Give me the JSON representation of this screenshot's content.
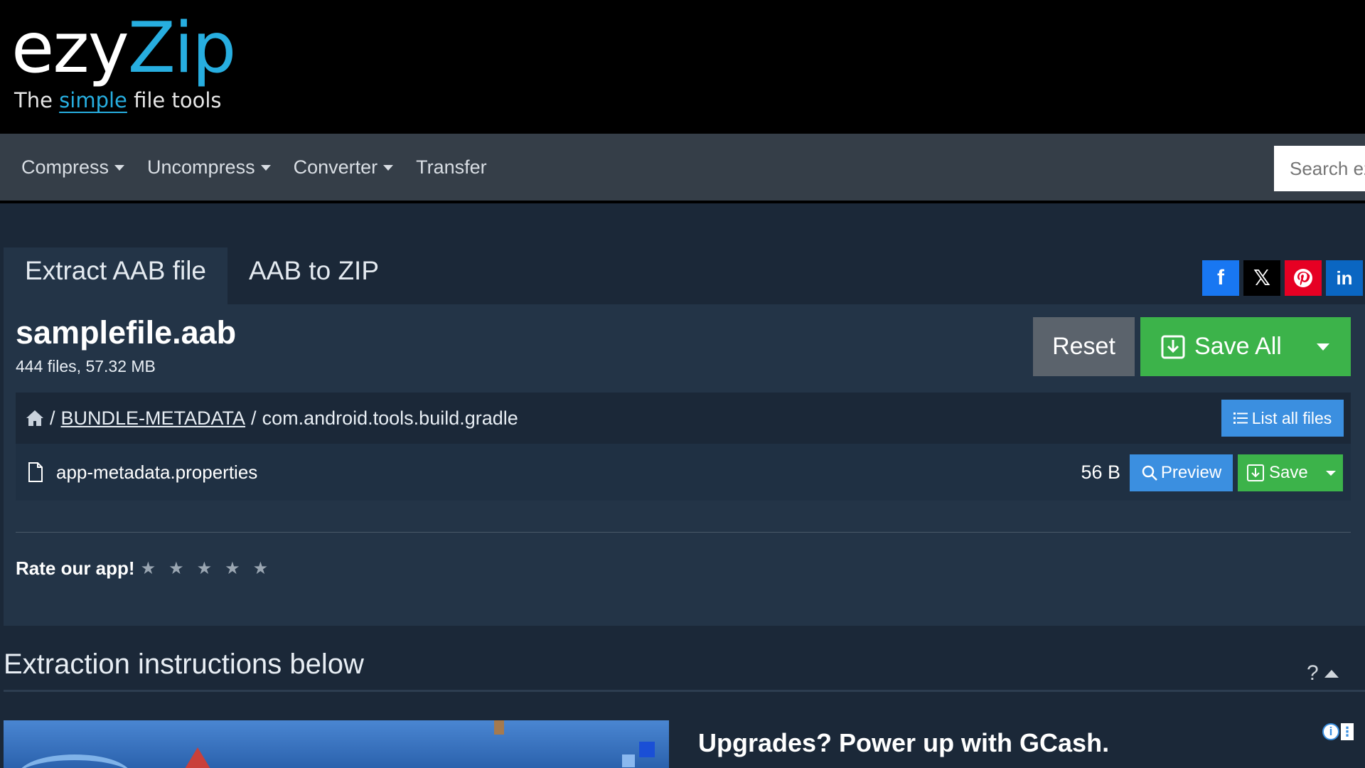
{
  "logo": {
    "word_left": "ezy",
    "word_right": "Zip",
    "tagline_pre": "The",
    "tagline_accent": "simple",
    "tagline_post": "file tools"
  },
  "nav": {
    "items": [
      {
        "label": "Compress",
        "has_dropdown": true
      },
      {
        "label": "Uncompress",
        "has_dropdown": true
      },
      {
        "label": "Converter",
        "has_dropdown": true
      },
      {
        "label": "Transfer",
        "has_dropdown": false
      }
    ],
    "search_placeholder": "Search ezyZip"
  },
  "tabs": [
    {
      "label": "Extract AAB file",
      "active": true
    },
    {
      "label": "AAB to ZIP",
      "active": false
    }
  ],
  "social": {
    "icons": [
      "facebook-icon",
      "x-icon",
      "pinterest-icon",
      "linkedin-icon"
    ],
    "colors": {
      "facebook": "#1877f2",
      "x": "#000000",
      "pinterest": "#e60023",
      "linkedin": "#0a66c2"
    },
    "fb_glyph": "f",
    "x_glyph": "𝕏",
    "pin_glyph": "P",
    "li_glyph": "in"
  },
  "archive": {
    "name": "samplefile.aab",
    "summary": "444 files, 57.32 MB",
    "reset_label": "Reset",
    "save_all_label": "Save All"
  },
  "breadcrumb": {
    "sep1": "/",
    "folder": "BUNDLE-METADATA",
    "sep2": "/",
    "current": "com.android.tools.build.gradle",
    "list_all_label": "List all files"
  },
  "files": [
    {
      "name": "app-metadata.properties",
      "size": "56 B",
      "preview_label": "Preview",
      "save_label": "Save"
    }
  ],
  "rating": {
    "label": "Rate our app!",
    "stars": [
      "★",
      "★",
      "★",
      "★",
      "★"
    ],
    "value": 0
  },
  "instructions": {
    "title": "Extraction instructions below",
    "help": "?"
  },
  "ad": {
    "headline": "Upgrades? Power up with GCash."
  },
  "colors": {
    "accent": "#27aee0",
    "primary": "#3b8fe0",
    "success": "#3cb34a",
    "background": "#1b2838",
    "panel": "#233447",
    "navbar": "#353e48"
  }
}
